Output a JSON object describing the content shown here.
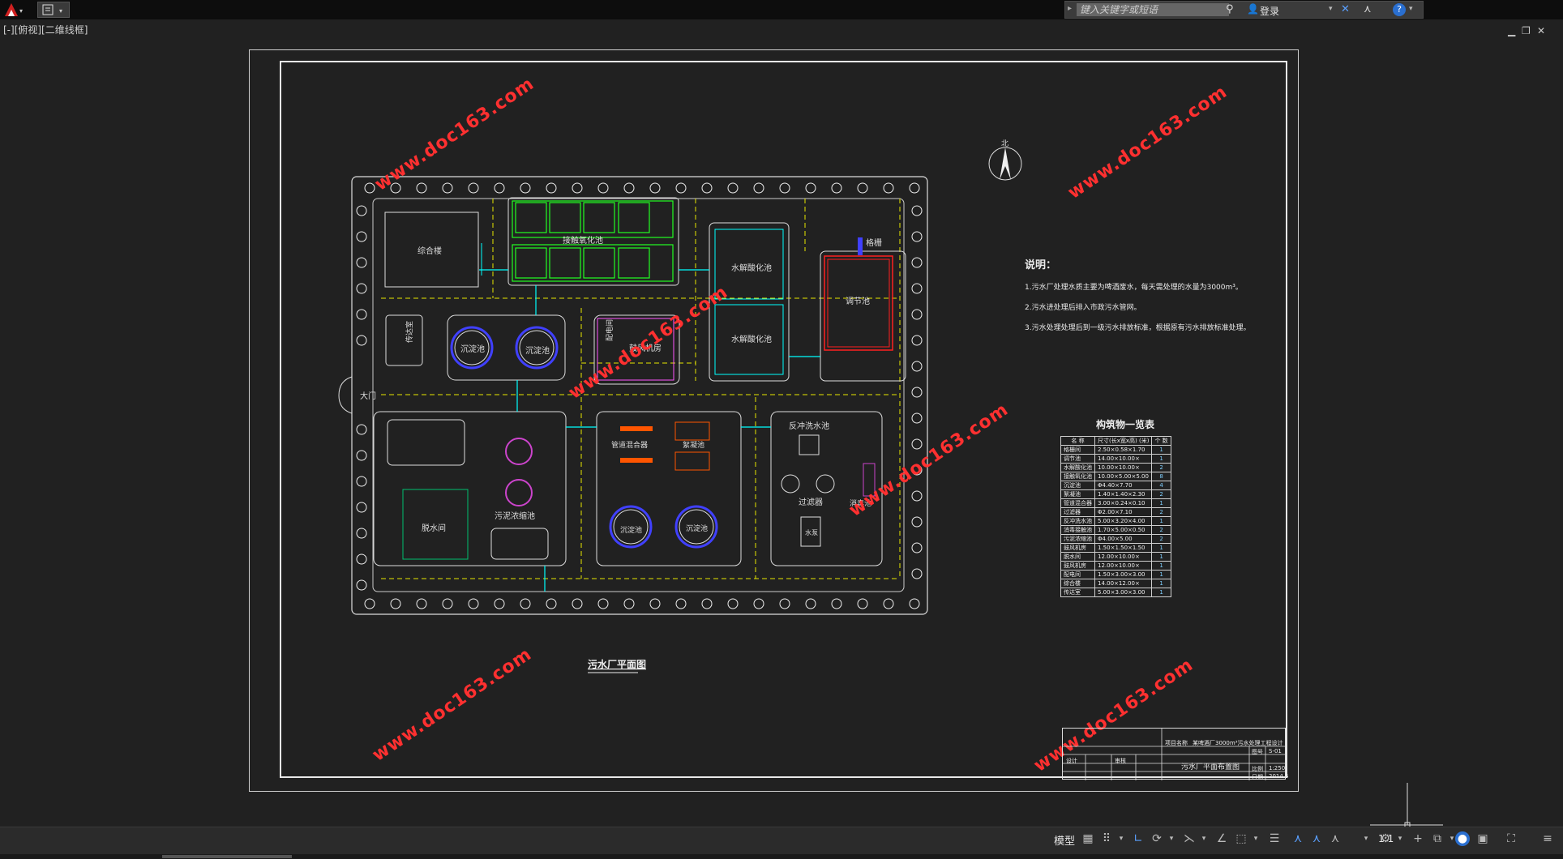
{
  "app": {
    "search_placeholder": "键入关键字或短语",
    "login_label": "登录",
    "viewport_label": "[-][俯视][二维线框]"
  },
  "drawing": {
    "title": "污水厂平面图",
    "north_label": "北",
    "gate_label": "大门",
    "buildings": {
      "zonghe": "综合楼",
      "jiechu": "接触氧化池",
      "shuijie1": "水解酸化池",
      "shuijie2": "水解酸化池",
      "tiaojie": "调节池",
      "geshan": "格栅",
      "chuansuoshi": "传达室",
      "chendian1": "沉淀池",
      "chendian2": "沉淀池",
      "gufeng": "鼓风机房",
      "peidian": "配电间",
      "wuni": "污泥浓缩池",
      "tuoshui": "脱水间",
      "guandao": "管道混合器",
      "jianing": "絮凝池",
      "chendian3": "沉淀池",
      "chendian4": "沉淀池",
      "fanchong": "反冲洗水池",
      "guolv": "过滤器",
      "xiaodu": "消毒池",
      "shuibeng": "水泵"
    },
    "watermark": "www.doc163.com"
  },
  "notes": {
    "heading": "说明：",
    "lines": [
      "1.污水厂处理水质主要为啤酒废水，每天需处理的水量为3000m³。",
      "2.污水进处理后排入市政污水管网。",
      "3.污水处理处理后到一级污水排放标准，根据原有污水排放标准处理。"
    ]
  },
  "structures": {
    "title": "构筑物一览表",
    "headers": [
      "名 称",
      "尺寸(长x宽x高) (米)",
      "个 数"
    ],
    "rows": [
      [
        "格栅间",
        "2.50×0.58×1.70",
        "1"
      ],
      [
        "调节池",
        "14.00×10.00×",
        "1"
      ],
      [
        "水解酸化池",
        "10.00×10.00×",
        "2"
      ],
      [
        "接触氧化池",
        "10.00×5.00×5.00",
        "8"
      ],
      [
        "沉淀池",
        "Φ4.40×7.70",
        "4"
      ],
      [
        "絮凝池",
        "1.40×1.40×2.30",
        "2"
      ],
      [
        "管道混合器",
        "3.00×0.24×0.10",
        "1"
      ],
      [
        "过滤器",
        "Φ2.00×7.10",
        "2"
      ],
      [
        "反冲洗水池",
        "5.00×3.20×4.00",
        "1"
      ],
      [
        "消毒接触池",
        "1.70×5.00×0.50",
        "2"
      ],
      [
        "污泥浓缩池",
        "Φ4.00×5.00",
        "2"
      ],
      [
        "鼓风机房",
        "1.50×1.50×1.50",
        "1"
      ],
      [
        "脱水间",
        "12.00×10.00×",
        "1"
      ],
      [
        "鼓风机房",
        "12.00×10.00×",
        "1"
      ],
      [
        "配电间",
        "1.50×3.00×3.00",
        "1"
      ],
      [
        "综合楼",
        "14.00×12.00×",
        "1"
      ],
      [
        "传达室",
        "5.00×3.00×3.00",
        "1"
      ]
    ]
  },
  "titleblock": {
    "project": "项目名称",
    "project_value": "某啤酒厂3000m³污水处理工程设计",
    "drawing_name": "污水厂平面布置图",
    "designer": "设计",
    "checker": "审核",
    "drawing_no_label": "图号",
    "drawing_no": "S-01",
    "scale_label": "比例",
    "scale": "1:250",
    "date_label": "日期",
    "date": "2014.5"
  },
  "statusbar": {
    "model_tab": "模型",
    "scale": "1:1"
  }
}
